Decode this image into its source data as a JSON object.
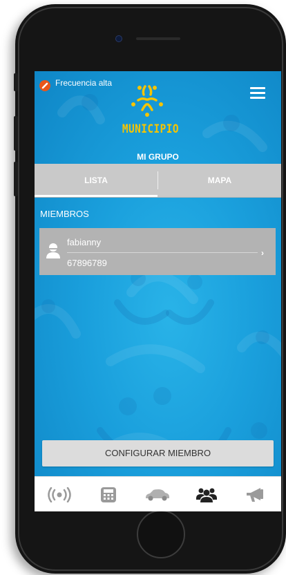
{
  "status": {
    "frequency_label": "Frecuencia alta"
  },
  "header": {
    "brand": "MUNICIPIO",
    "group_title": "MI GRUPO"
  },
  "tabs": [
    {
      "label": "LISTA",
      "active": true
    },
    {
      "label": "MAPA",
      "active": false
    }
  ],
  "members_section": {
    "title": "MIEMBROS",
    "members": [
      {
        "name": "fabianny",
        "phone": "67896789"
      }
    ]
  },
  "config_button": {
    "label": "CONFIGURAR MIEMBRO"
  },
  "bottom_nav": [
    {
      "icon": "broadcast-icon",
      "active": false
    },
    {
      "icon": "calculator-icon",
      "active": false
    },
    {
      "icon": "car-icon",
      "active": false
    },
    {
      "icon": "group-icon",
      "active": true
    },
    {
      "icon": "megaphone-icon",
      "active": false
    }
  ],
  "colors": {
    "screen_bg": "#1a9fdc",
    "brand": "#f5c400",
    "tab_bar": "#c9c9c9",
    "card": "#b3b3b3",
    "nav_inactive": "#9a9a9a",
    "nav_active": "#222222"
  }
}
